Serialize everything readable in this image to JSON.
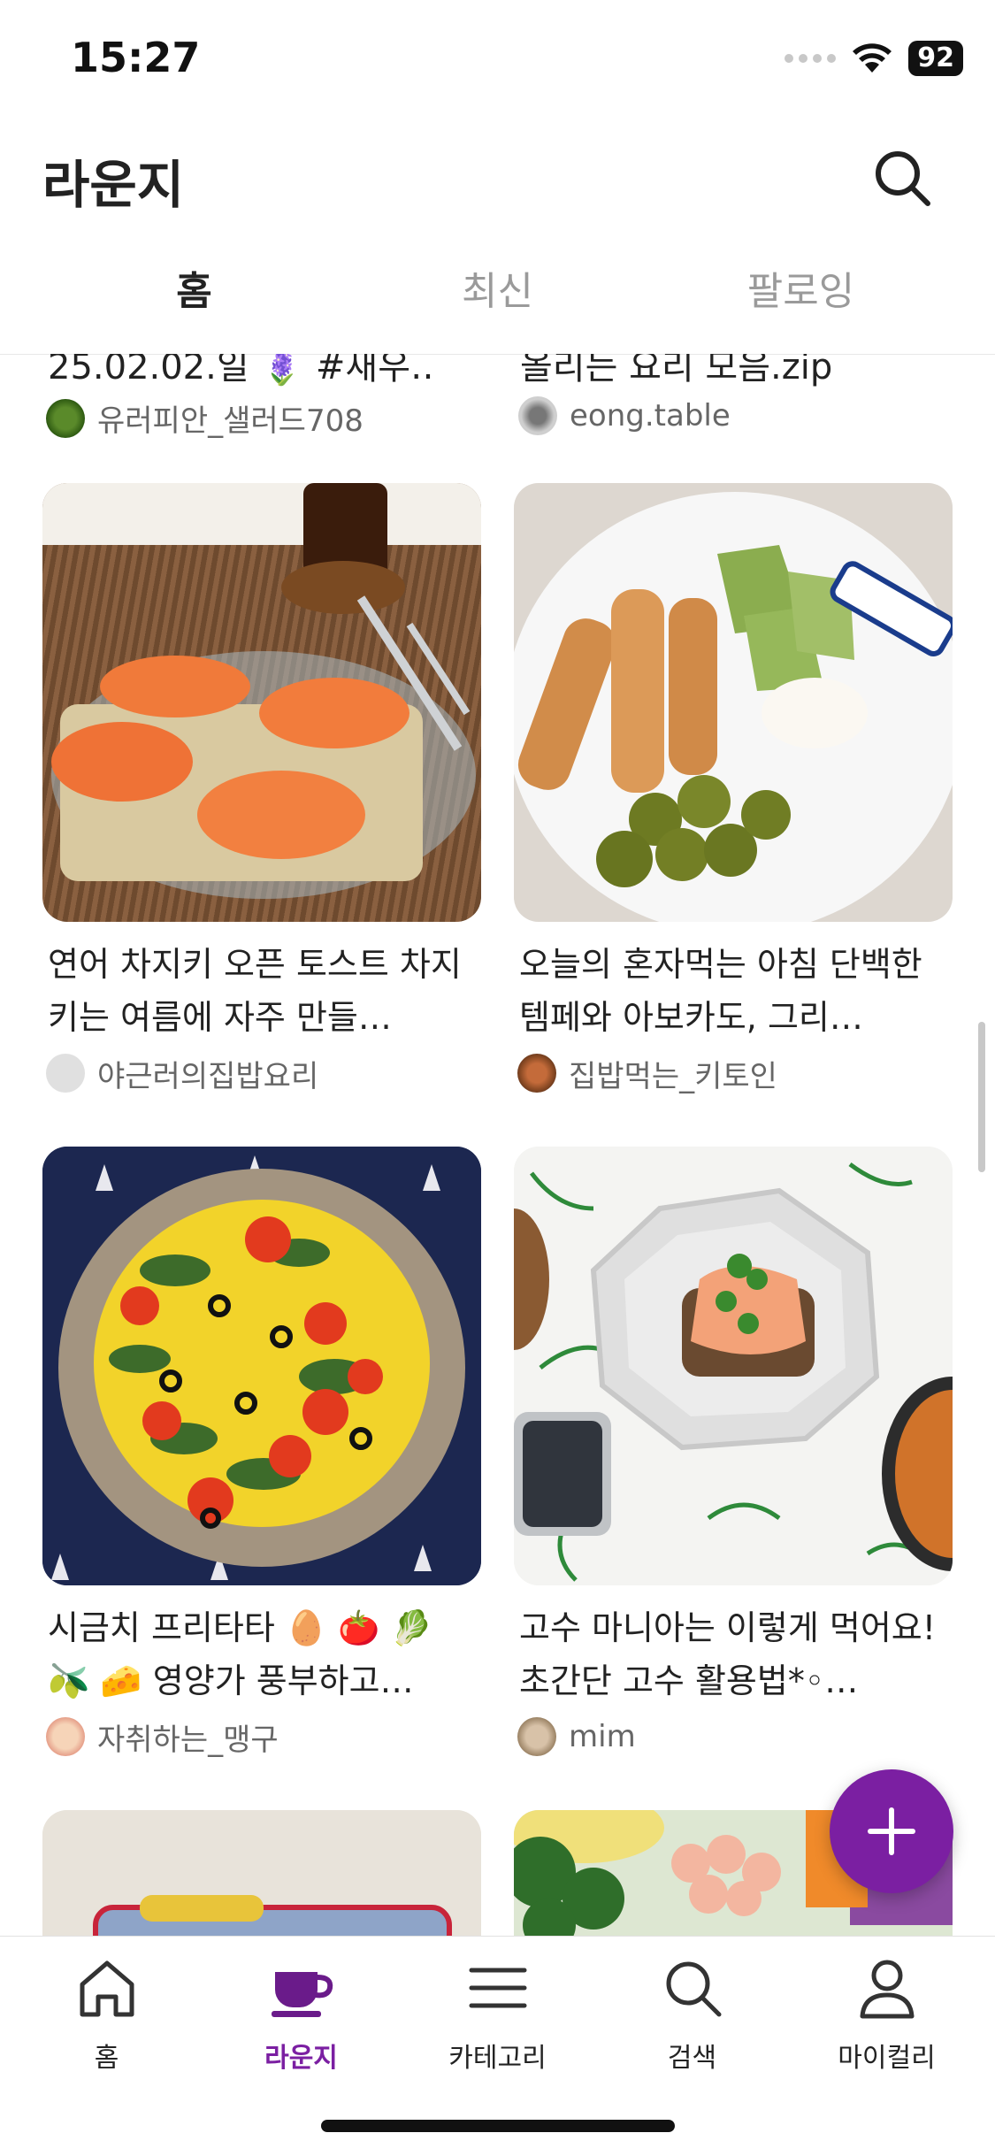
{
  "status_bar": {
    "time": "15:27",
    "battery": "92"
  },
  "header": {
    "title": "라운지"
  },
  "tabs": [
    {
      "label": "홈",
      "active": true
    },
    {
      "label": "최신",
      "active": false
    },
    {
      "label": "팔로잉",
      "active": false
    }
  ],
  "feed": {
    "cut_row": {
      "left_title": "25.02.02.일 🪻 #새우…",
      "left_author": "유러피안_샐러드708",
      "right_title": "올리는 요리 모음.zip",
      "right_author": "eong.table"
    },
    "cards": [
      {
        "title": "연어 차지키 오픈 토스트 차지키는 여름에 자주 만들…",
        "author": "야근러의집밥요리"
      },
      {
        "title": "오늘의 혼자먹는 아침 단백한 템페와 아보카도,  그리…",
        "author": "집밥먹는_키토인"
      },
      {
        "title": "시금치 프리타타 🥚 🍅 🥬 🫒 🧀  영양가 풍부하고…",
        "author": "자취하는_맹구"
      },
      {
        "title": "고수 마니아는 이렇게 먹어요! 초간단 고수 활용법*◦…",
        "author": "mim"
      }
    ]
  },
  "bottom_nav": [
    {
      "label": "홈",
      "icon": "home-icon"
    },
    {
      "label": "라운지",
      "icon": "cup-icon",
      "active": true
    },
    {
      "label": "카테고리",
      "icon": "menu-icon"
    },
    {
      "label": "검색",
      "icon": "search-icon"
    },
    {
      "label": "마이컬리",
      "icon": "user-icon"
    }
  ],
  "colors": {
    "accent": "#7b1fa2"
  }
}
